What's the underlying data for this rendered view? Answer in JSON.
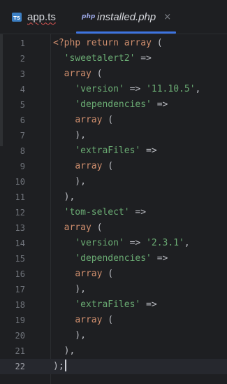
{
  "tabs": [
    {
      "icon": "typescript-file-icon",
      "icon_text": "TS",
      "label": "app.ts",
      "active": false
    },
    {
      "icon": "php-file-icon",
      "icon_text": "php",
      "label": "installed.php",
      "active": true,
      "close": "×"
    }
  ],
  "colors": {
    "background": "#1e1f22",
    "keyword": "#cf8e6d",
    "string": "#6aab73",
    "punctuation": "#bcbec4",
    "line_number": "#6f737a",
    "active_tab_underline": "#3d74e0"
  },
  "editor": {
    "active_line": 22,
    "lines": [
      [
        {
          "t": "<?php",
          "c": "k"
        },
        {
          "t": " "
        },
        {
          "t": "return",
          "c": "k"
        },
        {
          "t": " "
        },
        {
          "t": "array",
          "c": "k"
        },
        {
          "t": " ("
        }
      ],
      [
        {
          "t": "  "
        },
        {
          "t": "'sweetalert2'",
          "c": "s"
        },
        {
          "t": " =>"
        }
      ],
      [
        {
          "t": "  "
        },
        {
          "t": "array",
          "c": "k"
        },
        {
          "t": " ("
        }
      ],
      [
        {
          "t": "    "
        },
        {
          "t": "'version'",
          "c": "s"
        },
        {
          "t": " => "
        },
        {
          "t": "'11.10.5'",
          "c": "s"
        },
        {
          "t": ","
        }
      ],
      [
        {
          "t": "    "
        },
        {
          "t": "'dependencies'",
          "c": "s"
        },
        {
          "t": " =>"
        }
      ],
      [
        {
          "t": "    "
        },
        {
          "t": "array",
          "c": "k"
        },
        {
          "t": " ("
        }
      ],
      [
        {
          "t": "    ),"
        }
      ],
      [
        {
          "t": "    "
        },
        {
          "t": "'extraFiles'",
          "c": "s"
        },
        {
          "t": " =>"
        }
      ],
      [
        {
          "t": "    "
        },
        {
          "t": "array",
          "c": "k"
        },
        {
          "t": " ("
        }
      ],
      [
        {
          "t": "    ),"
        }
      ],
      [
        {
          "t": "  ),"
        }
      ],
      [
        {
          "t": "  "
        },
        {
          "t": "'tom-select'",
          "c": "s"
        },
        {
          "t": " =>"
        }
      ],
      [
        {
          "t": "  "
        },
        {
          "t": "array",
          "c": "k"
        },
        {
          "t": " ("
        }
      ],
      [
        {
          "t": "    "
        },
        {
          "t": "'version'",
          "c": "s"
        },
        {
          "t": " => "
        },
        {
          "t": "'2.3.1'",
          "c": "s"
        },
        {
          "t": ","
        }
      ],
      [
        {
          "t": "    "
        },
        {
          "t": "'dependencies'",
          "c": "s"
        },
        {
          "t": " =>"
        }
      ],
      [
        {
          "t": "    "
        },
        {
          "t": "array",
          "c": "k"
        },
        {
          "t": " ("
        }
      ],
      [
        {
          "t": "    ),"
        }
      ],
      [
        {
          "t": "    "
        },
        {
          "t": "'extraFiles'",
          "c": "s"
        },
        {
          "t": " =>"
        }
      ],
      [
        {
          "t": "    "
        },
        {
          "t": "array",
          "c": "k"
        },
        {
          "t": " ("
        }
      ],
      [
        {
          "t": "    ),"
        }
      ],
      [
        {
          "t": "  ),"
        }
      ],
      [
        {
          "t": ");"
        }
      ]
    ]
  }
}
